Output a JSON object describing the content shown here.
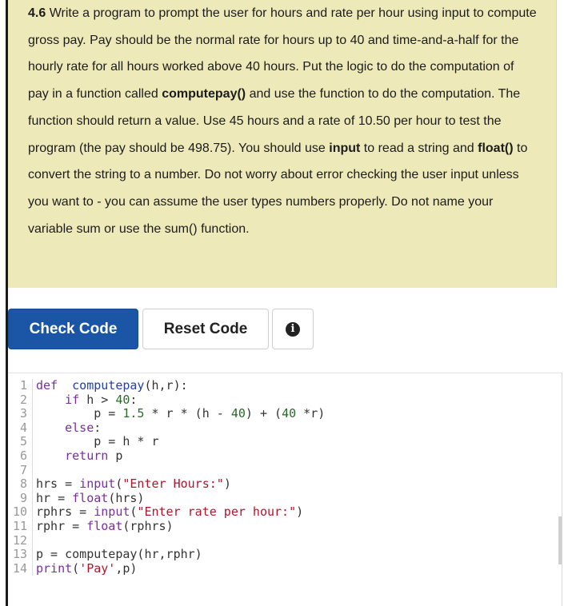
{
  "prompt": {
    "number": "4.6",
    "segments": [
      {
        "text": " Write a program to prompt the user for hours and rate per hour using input to compute gross pay. Pay should be the normal rate for hours up to 40 and time-and-a-half for the hourly rate for all hours worked above 40 hours. Put the logic to do the computation of pay in a function called ",
        "bold": false
      },
      {
        "text": "computepay()",
        "bold": true
      },
      {
        "text": " and use the function to do the computation. The function should return a value. Use 45 hours and a rate of 10.50 per hour to test the program (the pay should be 498.75). You should use ",
        "bold": false
      },
      {
        "text": "input",
        "bold": true
      },
      {
        "text": " to read a string and ",
        "bold": false
      },
      {
        "text": "float()",
        "bold": true
      },
      {
        "text": " to convert the string to a number. Do not worry about error checking the user input unless you want to - you can assume the user types numbers properly. Do not name your variable sum or use the sum() function.",
        "bold": false
      }
    ]
  },
  "buttons": {
    "check_label": "Check Code",
    "reset_label": "Reset Code",
    "info_glyph": "i"
  },
  "editor": {
    "lines": [
      {
        "n": "1",
        "tokens": [
          [
            "kw",
            "def"
          ],
          [
            "",
            "  "
          ],
          [
            "fn",
            "computepay"
          ],
          [
            "",
            "(h,r):"
          ]
        ]
      },
      {
        "n": "2",
        "tokens": [
          [
            "",
            "    "
          ],
          [
            "kw",
            "if"
          ],
          [
            "",
            " h > "
          ],
          [
            "num",
            "40"
          ],
          [
            "",
            ":"
          ]
        ]
      },
      {
        "n": "3",
        "tokens": [
          [
            "",
            "        p = "
          ],
          [
            "num",
            "1.5"
          ],
          [
            "",
            " * r * (h - "
          ],
          [
            "num",
            "40"
          ],
          [
            "",
            ") + ("
          ],
          [
            "num",
            "40"
          ],
          [
            "",
            " *r)"
          ]
        ]
      },
      {
        "n": "4",
        "tokens": [
          [
            "",
            "    "
          ],
          [
            "kw",
            "else"
          ],
          [
            "",
            ":"
          ]
        ]
      },
      {
        "n": "5",
        "tokens": [
          [
            "",
            "        p = h * r"
          ]
        ]
      },
      {
        "n": "6",
        "tokens": [
          [
            "",
            "    "
          ],
          [
            "kw",
            "return"
          ],
          [
            "",
            " p"
          ]
        ]
      },
      {
        "n": "7",
        "tokens": []
      },
      {
        "n": "8",
        "tokens": [
          [
            "",
            "hrs = "
          ],
          [
            "bi",
            "input"
          ],
          [
            "",
            "("
          ],
          [
            "str",
            "\"Enter Hours:\""
          ],
          [
            "",
            ")"
          ]
        ]
      },
      {
        "n": "9",
        "tokens": [
          [
            "",
            "hr = "
          ],
          [
            "bi",
            "float"
          ],
          [
            "",
            "(hrs)"
          ]
        ]
      },
      {
        "n": "10",
        "tokens": [
          [
            "",
            "rphrs = "
          ],
          [
            "bi",
            "input"
          ],
          [
            "",
            "("
          ],
          [
            "str",
            "\"Enter rate per hour:\""
          ],
          [
            "",
            ")"
          ]
        ]
      },
      {
        "n": "11",
        "tokens": [
          [
            "",
            "rphr = "
          ],
          [
            "bi",
            "float"
          ],
          [
            "",
            "(rphrs)"
          ]
        ]
      },
      {
        "n": "12",
        "tokens": []
      },
      {
        "n": "13",
        "tokens": [
          [
            "",
            "p = computepay(hr,rphr)"
          ]
        ]
      },
      {
        "n": "14",
        "tokens": [
          [
            "bi",
            "print"
          ],
          [
            "",
            "("
          ],
          [
            "str",
            "'Pay'"
          ],
          [
            "",
            ",p)"
          ]
        ]
      }
    ]
  }
}
